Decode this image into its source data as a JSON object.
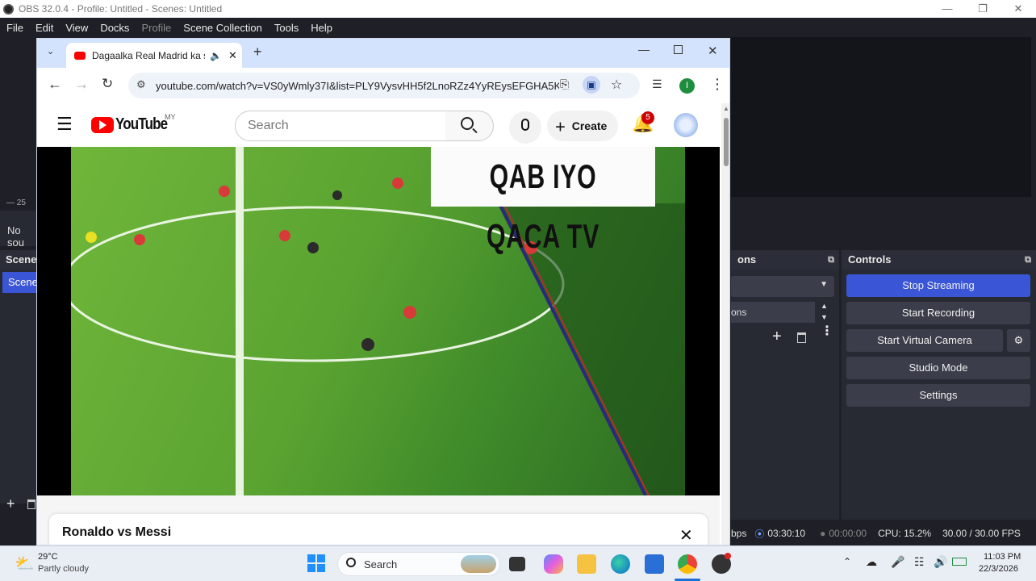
{
  "obs": {
    "title": "OBS 32.0.4 - Profile: Untitled - Scenes: Untitled",
    "menu": [
      "File",
      "Edit",
      "View",
      "Docks",
      "Profile",
      "Scene Collection",
      "Tools",
      "Help"
    ],
    "left_ruler_text": "25",
    "no_source_text": "No sou",
    "scenes_dock_title": "Scene",
    "scene_item": "Scene",
    "transitions_dock_title": "ons",
    "transitions_duration_label": "ons",
    "controls_dock_title": "Controls",
    "controls": {
      "stop_streaming": "Stop Streaming",
      "start_recording": "Start Recording",
      "start_virtual_camera": "Start Virtual Camera",
      "studio_mode": "Studio Mode",
      "settings": "Settings"
    },
    "status": {
      "bitrate": "bps",
      "stream_time": "03:30:10",
      "record_time": "00:00:00",
      "cpu": "CPU: 15.2%",
      "fps": "30.00 / 30.00 FPS"
    },
    "colors": {
      "accent": "#3a55d6",
      "dock_bg": "#272a33"
    }
  },
  "chrome": {
    "tab_title": "Dagaalka Real Madrid ka so",
    "url": "youtube.com/watch?v=VS0yWmly37I&list=PLY9VysvHH5f2LnoRZz4YyREysEFGHA5K...",
    "profile_initial": "I"
  },
  "youtube": {
    "logo_text": "YouTube",
    "region": "MY",
    "search_placeholder": "Search",
    "create_label": "Create",
    "notification_count": "5",
    "watermark_text": "QAB IYO QACA TV",
    "card_title": "Ronaldo vs Messi"
  },
  "taskbar": {
    "weather_temp": "29°C",
    "weather_desc": "Partly cloudy",
    "search_label": "Search",
    "time": "11:03 PM",
    "date": "22/3/2026"
  }
}
